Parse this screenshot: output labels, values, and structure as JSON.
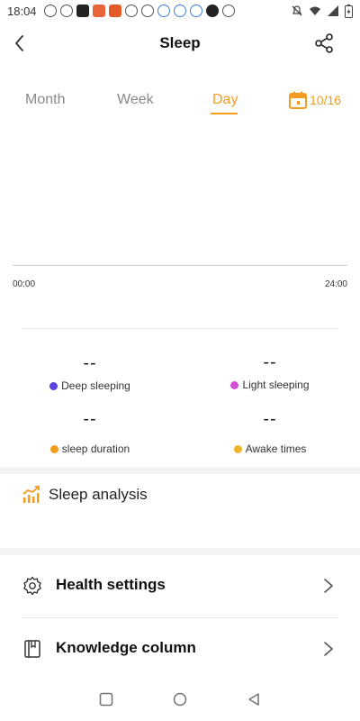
{
  "status_bar": {
    "time": "18:04"
  },
  "header": {
    "title": "Sleep"
  },
  "tabs": [
    {
      "label": "Month",
      "active": false
    },
    {
      "label": "Week",
      "active": false
    },
    {
      "label": "Day",
      "active": true
    }
  ],
  "date": {
    "label": "10/16"
  },
  "chart": {
    "start_label": "00:00",
    "end_label": "24:00"
  },
  "stats": {
    "deep_sleeping": {
      "value": "--",
      "label": "Deep sleeping",
      "color": "#5b3fe0"
    },
    "light_sleeping": {
      "value": "--",
      "label": "Light sleeping",
      "color": "#d24ed6"
    },
    "sleep_duration": {
      "value": "--",
      "label": "sleep duration",
      "color": "#f39c1f"
    },
    "awake_times": {
      "value": "--",
      "label": "Awake times",
      "color": "#f0b429"
    }
  },
  "analysis": {
    "label": "Sleep analysis"
  },
  "menu": {
    "health_settings": "Health settings",
    "knowledge_column": "Knowledge column"
  },
  "colors": {
    "accent": "#f39c1f"
  }
}
